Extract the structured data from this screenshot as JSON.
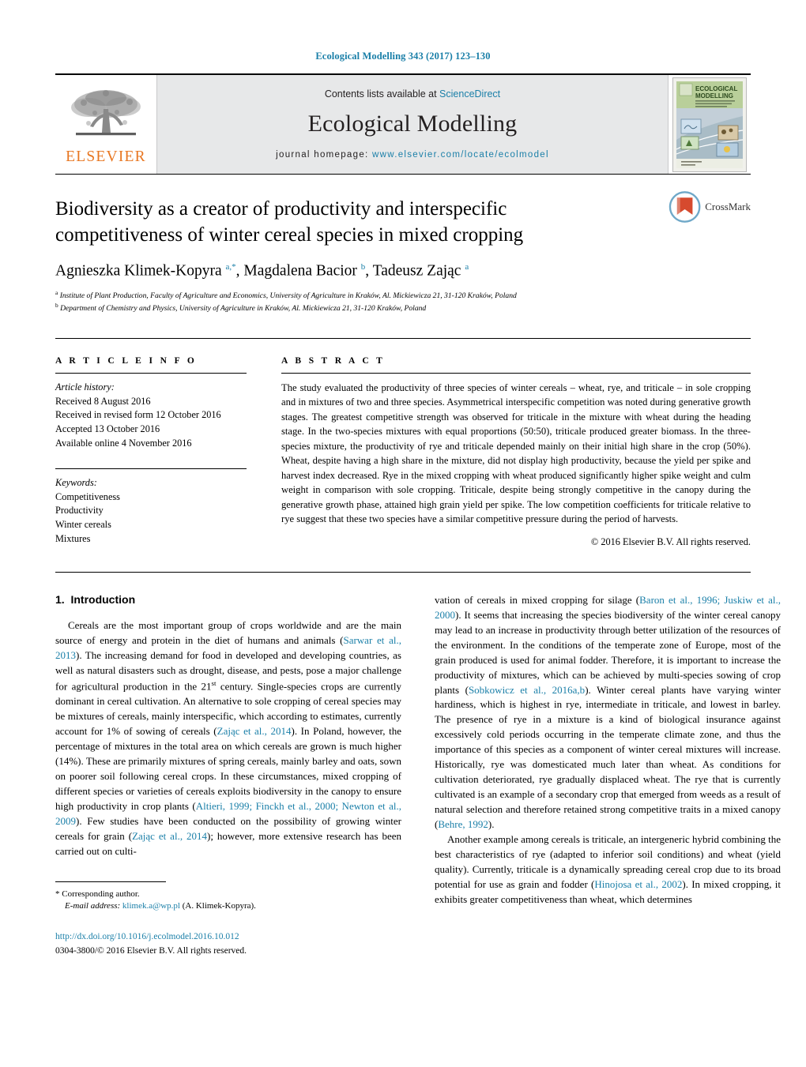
{
  "running_head": "Ecological Modelling 343 (2017) 123–130",
  "masthead": {
    "publisher_name": "ELSEVIER",
    "contents_prefix": "Contents lists available at ",
    "contents_link": "ScienceDirect",
    "journal_title": "Ecological Modelling",
    "homepage_label": "journal homepage:",
    "homepage_url": "www.elsevier.com/locate/ecolmodel",
    "cover_title_line1": "ECOLOGICAL",
    "cover_title_line2": "MODELLING"
  },
  "article": {
    "title": "Biodiversity as a creator of productivity and interspecific competitiveness of winter cereal species in mixed cropping",
    "crossmark_label": "CrossMark",
    "authors_html": "Agnieszka Klimek-Kopyra <sup>a,*</sup>, Magdalena Bacior <sup>b</sup>, Tadeusz Zając <sup>a</sup>",
    "affiliations": [
      {
        "marker": "a",
        "text": "Institute of Plant Production, Faculty of Agriculture and Economics, University of Agriculture in Kraków, Al. Mickiewicza 21, 31-120 Kraków, Poland"
      },
      {
        "marker": "b",
        "text": "Department of Chemistry and Physics, University of Agriculture in Kraków, Al. Mickiewicza 21, 31-120 Kraków, Poland"
      }
    ]
  },
  "article_info": {
    "heading": "A R T I C L E    I N F O",
    "history_label": "Article history:",
    "history": [
      "Received 8 August 2016",
      "Received in revised form 12 October 2016",
      "Accepted 13 October 2016",
      "Available online 4 November 2016"
    ],
    "keywords_label": "Keywords:",
    "keywords": [
      "Competitiveness",
      "Productivity",
      "Winter cereals",
      "Mixtures"
    ]
  },
  "abstract": {
    "heading": "A B S T R A C T",
    "text": "The study evaluated the productivity of three species of winter cereals – wheat, rye, and triticale – in sole cropping and in mixtures of two and three species. Asymmetrical interspecific competition was noted during generative growth stages. The greatest competitive strength was observed for triticale in the mixture with wheat during the heading stage. In the two-species mixtures with equal proportions (50:50), triticale produced greater biomass. In the three-species mixture, the productivity of rye and triticale depended mainly on their initial high share in the crop (50%). Wheat, despite having a high share in the mixture, did not display high productivity, because the yield per spike and harvest index decreased. Rye in the mixed cropping with wheat produced significantly higher spike weight and culm weight in comparison with sole cropping. Triticale, despite being strongly competitive in the canopy during the generative growth phase, attained high grain yield per spike. The low competition coefficients for triticale relative to rye suggest that these two species have a similar competitive pressure during the period of harvests.",
    "copyright": "© 2016 Elsevier B.V. All rights reserved."
  },
  "introduction": {
    "section_number": "1.",
    "section_title": "Introduction",
    "left_paragraph_html": "Cereals are the most important group of crops worldwide and are the main source of energy and protein in the diet of humans and animals (<span class=\"ref\">Sarwar et al., 2013</span>). The increasing demand for food in developed and developing countries, as well as natural disasters such as drought, disease, and pests, pose a major challenge for agricultural production in the 21<sup class=\"mini\">st</sup> century. Single-species crops are currently dominant in cereal cultivation. An alternative to sole cropping of cereal species may be mixtures of cereals, mainly interspecific, which according to estimates, currently account for 1% of sowing of cereals (<span class=\"ref\">Zając et al., 2014</span>). In Poland, however, the percentage of mixtures in the total area on which cereals are grown is much higher (14%). These are primarily mixtures of spring cereals, mainly barley and oats, sown on poorer soil following cereal crops. In these circumstances, mixed cropping of different species or varieties of cereals exploits biodiversity in the canopy to ensure high productivity in crop plants (<span class=\"ref\">Altieri, 1999; Finckh et al., 2000; Newton et al., 2009</span>). Few studies have been conducted on the possibility of growing winter cereals for grain (<span class=\"ref\">Zając et al., 2014</span>); however, more extensive research has been carried out on culti-",
    "right_paragraph_1_html": "vation of cereals in mixed cropping for silage (<span class=\"ref\">Baron et al., 1996; Juskiw et al., 2000</span>). It seems that increasing the species biodiversity of the winter cereal canopy may lead to an increase in productivity through better utilization of the resources of the environment. In the conditions of the temperate zone of Europe, most of the grain produced is used for animal fodder. Therefore, it is important to increase the productivity of mixtures, which can be achieved by multi-species sowing of crop plants (<span class=\"ref\">Sobkowicz et al., 2016a,b</span>). Winter cereal plants have varying winter hardiness, which is highest in rye, intermediate in triticale, and lowest in barley. The presence of rye in a mixture is a kind of biological insurance against excessively cold periods occurring in the temperate climate zone, and thus the importance of this species as a component of winter cereal mixtures will increase. Historically, rye was domesticated much later than wheat. As conditions for cultivation deteriorated, rye gradually displaced wheat. The rye that is currently cultivated is an example of a secondary crop that emerged from weeds as a result of natural selection and therefore retained strong competitive traits in a mixed canopy (<span class=\"ref\">Behre, 1992</span>).",
    "right_paragraph_2_html": "Another example among cereals is triticale, an intergeneric hybrid combining the best characteristics of rye (adapted to inferior soil conditions) and wheat (yield quality). Currently, triticale is a dynamically spreading cereal crop due to its broad potential for use as grain and fodder (<span class=\"ref\">Hinojosa et al., 2002</span>). In mixed cropping, it exhibits greater competitiveness than wheat, which determines"
  },
  "footer": {
    "corresponding_marker": "*",
    "corresponding_label": "Corresponding author.",
    "email_label": "E-mail address:",
    "email": "klimek.a@wp.pl",
    "email_owner": "(A. Klimek-Kopyra).",
    "doi": "http://dx.doi.org/10.1016/j.ecolmodel.2016.10.012",
    "issn_line": "0304-3800/© 2016 Elsevier B.V. All rights reserved."
  },
  "colors": {
    "link": "#1a7fa8",
    "elsevier_orange": "#E87722",
    "masthead_bg": "#e7e8e9"
  }
}
